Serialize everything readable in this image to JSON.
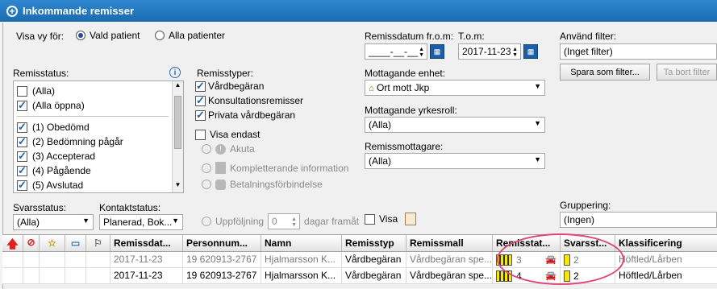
{
  "window": {
    "title": "Inkommande remisser"
  },
  "view": {
    "label": "Visa vy för:",
    "option_selected": "Vald patient",
    "option_other": "Alla patienter"
  },
  "remissstatus": {
    "label": "Remisstatus:",
    "items": [
      "(Alla)",
      "(Alla öppna)",
      "(1) Obedömd",
      "(2) Bedömning pågår",
      "(3) Accepterad",
      "(4) Pågående",
      "(5) Avslutad"
    ]
  },
  "remisstyper": {
    "label": "Remisstyper:",
    "items": [
      "Vårdbegäran",
      "Konsultationsremisser",
      "Privata vårdbegäran"
    ],
    "visa_endast": "Visa endast",
    "sub": [
      "Akuta",
      "Kompletterande information",
      "Betalningsförbindelse"
    ]
  },
  "date": {
    "from_label": "Remissdatum fr.o.m:",
    "from_value": "____-__-__",
    "to_label": "T.o.m:",
    "to_value": "2017-11-23"
  },
  "mottagande_enhet": {
    "label": "Mottagande enhet:",
    "value": "Ort mott Jkp"
  },
  "yrkesroll": {
    "label": "Mottagande yrkesroll:",
    "value": "(Alla)"
  },
  "mottagare": {
    "label": "Remissmottagare:",
    "value": "(Alla)"
  },
  "filter": {
    "label": "Använd filter:",
    "value": "(Inget filter)",
    "save": "Spara som filter...",
    "delete": "Ta bort filter"
  },
  "svarsstatus": {
    "label": "Svarsstatus:",
    "value": "(Alla)"
  },
  "kontaktstatus": {
    "label": "Kontaktstatus:",
    "value": "Planerad, Bok..."
  },
  "uppfoljning": {
    "label": "Uppföljning",
    "value": "0",
    "suffix": "dagar framåt",
    "visa": "Visa"
  },
  "gruppering": {
    "label": "Gruppering:",
    "value": "(Ingen)"
  },
  "table": {
    "headers": [
      "Remissdat...",
      "Personnum...",
      "Namn",
      "Remisstyp",
      "Remissmall",
      "Remisstat...",
      "Svarsst...",
      "Klassificering"
    ],
    "rows": [
      {
        "date": "2017-11-23",
        "pnr": "19 620913-2767",
        "name": "Hjalmarsson K...",
        "type": "Vårdbegäran",
        "mall": "Vårdbegäran spe...",
        "status": "3",
        "svar": "2",
        "klass": "Höftled/Lårben"
      },
      {
        "date": "2017-11-23",
        "pnr": "19 620913-2767",
        "name": "Hjalmarsson K...",
        "type": "Vårdbegäran",
        "mall": "Vårdbegäran spe...",
        "status": "4",
        "svar": "2",
        "klass": "Höftled/Lårben"
      }
    ]
  },
  "colors": {
    "title": "#1f75c0",
    "highlight": "#e0457b",
    "red_arrow": "#e0201a"
  }
}
